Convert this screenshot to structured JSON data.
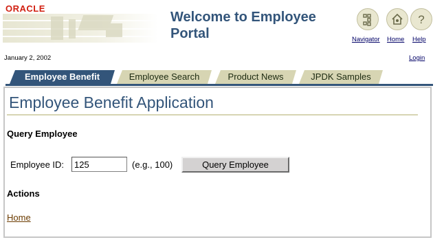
{
  "header": {
    "logo": "ORACLE",
    "portal_title": "Welcome to Employee Portal",
    "nav": [
      {
        "label": "Navigator",
        "icon": "navigator-icon"
      },
      {
        "label": "Home",
        "icon": "home-icon"
      },
      {
        "label": "Help",
        "icon": "help-icon"
      }
    ],
    "date": "January 2, 2002",
    "login_label": "Login"
  },
  "tabs": [
    {
      "label": "Employee Benefit",
      "active": true
    },
    {
      "label": "Employee Search",
      "active": false
    },
    {
      "label": "Product News",
      "active": false
    },
    {
      "label": "JPDK Samples",
      "active": false
    }
  ],
  "app": {
    "title": "Employee Benefit Application",
    "query_heading": "Query Employee",
    "employee_id_label": "Employee ID:",
    "employee_id_value": "125",
    "employee_id_hint": "(e.g., 100)",
    "query_button": "Query Employee",
    "actions_heading": "Actions",
    "home_link": "Home"
  },
  "colors": {
    "accent": "#33557a",
    "tab_inactive": "#d7d5b3",
    "logo_red": "#d11f10"
  }
}
